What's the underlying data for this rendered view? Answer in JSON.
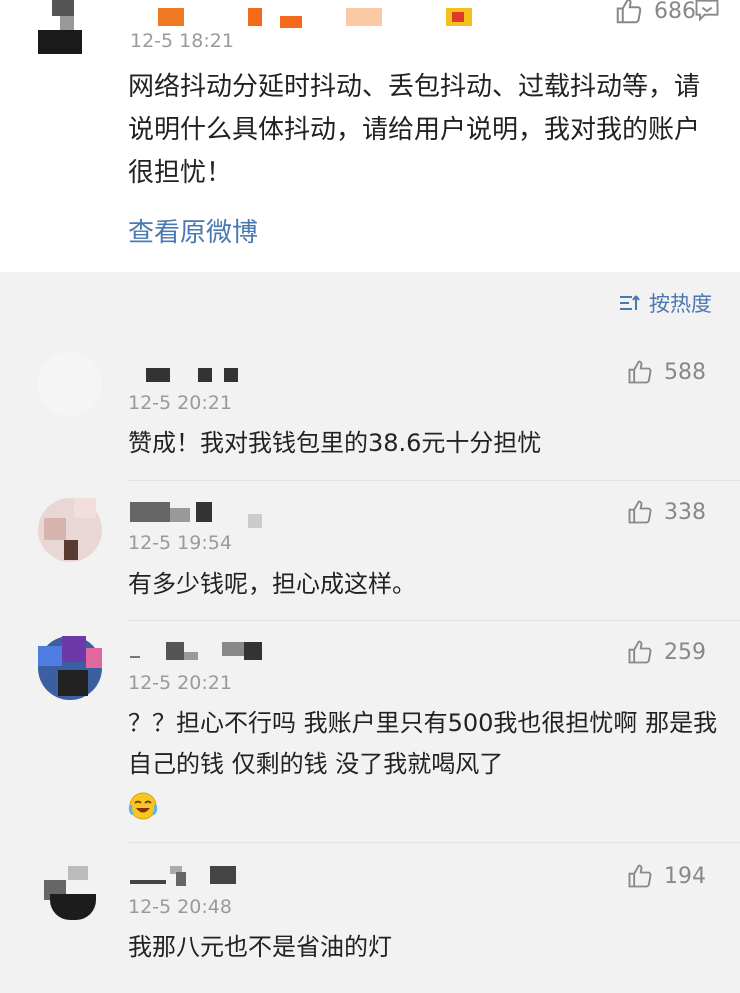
{
  "post": {
    "time": "12-5 18:21",
    "likes": "686",
    "body": "网络抖动分延时抖动、丢包抖动、过载抖动等，请说明什么具体抖动，请给用户说明，我对我的账户很担忧！",
    "view_original": "查看原微博"
  },
  "sort": {
    "label": "按热度"
  },
  "comments": [
    {
      "time": "12-5 20:21",
      "likes": "588",
      "text": "赞成！我对我钱包里的38.6元十分担忧"
    },
    {
      "time": "12-5 19:54",
      "likes": "338",
      "text": "有多少钱呢，担心成这样。"
    },
    {
      "time": "12-5 20:21",
      "likes": "259",
      "text": "？？担心不行吗 我账户里只有500我也很担忧啊 那是我自己的钱 仅剩的钱 没了我就喝风了"
    },
    {
      "time": "12-5 20:48",
      "likes": "194",
      "text": "我那八元也不是省油的灯"
    }
  ],
  "icons": {
    "like": "thumbs-up-icon",
    "share": "share-icon",
    "sort": "sort-icon",
    "emoji": "laughing-crying-emoji"
  },
  "colors": {
    "link": "#4a78b3",
    "meta": "#9a9a9a",
    "text": "#222222",
    "background": "#f2f2f2"
  }
}
